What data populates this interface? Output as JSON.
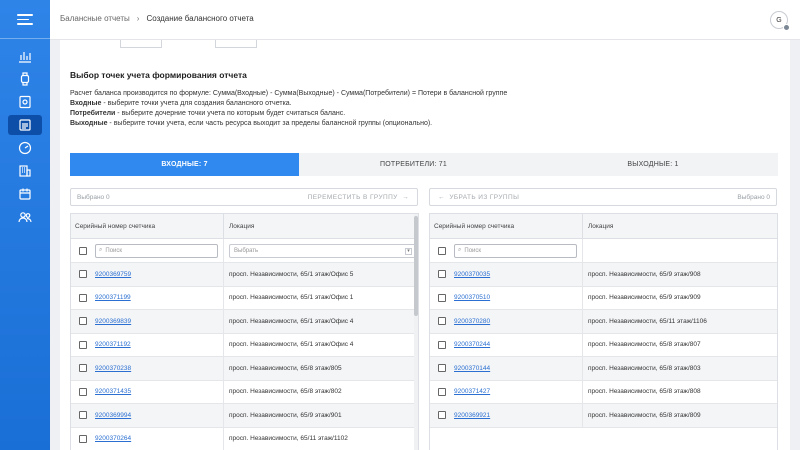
{
  "breadcrumb": {
    "parent": "Балансные отчеты",
    "separator": "›",
    "current": "Создание балансного отчета"
  },
  "user": {
    "initial": "G"
  },
  "sidebar": {
    "items": [
      {
        "icon": "chart-icon",
        "active": false
      },
      {
        "icon": "watch-icon",
        "active": false
      },
      {
        "icon": "settings-doc-icon",
        "active": false
      },
      {
        "icon": "report-icon",
        "active": true
      },
      {
        "icon": "gauge-icon",
        "active": false
      },
      {
        "icon": "building-icon",
        "active": false
      },
      {
        "icon": "calendar-icon",
        "active": false
      },
      {
        "icon": "users-icon",
        "active": false
      }
    ]
  },
  "section": {
    "title": "Выбор точек учета формирования отчета",
    "formula": "Расчет баланса производится по формуле: Сумма(Входные) - Сумма(Выходные) - Сумма(Потребители) = Потери в балансной группе",
    "inputs_term": "Входные",
    "inputs_desc": " - выберите точки учета для создания балансного отчетка.",
    "consumers_term": "Потребители",
    "consumers_desc": " - выберите дочерние точки учета по которым будет считаться баланс.",
    "outputs_term": "Выходные",
    "outputs_desc": " - выберите точки учета, если часть ресурса выходит за пределы балансной группы (опционально)."
  },
  "tabs": [
    {
      "label": "ВХОДНЫЕ: 7",
      "active": true
    },
    {
      "label": "ПОТРЕБИТЕЛИ: 71",
      "active": false
    },
    {
      "label": "ВЫХОДНЫЕ: 1",
      "active": false
    }
  ],
  "left_panel": {
    "selected": "Выбрано 0",
    "action": "ПЕРЕМЕСТИТЬ В ГРУППУ",
    "columns": {
      "serial": "Серийный номер счетчика",
      "location": "Локация"
    },
    "search_placeholder": "Поиск",
    "select_placeholder": "Выбрать",
    "rows": [
      {
        "serial": "9200369759",
        "location": "просп. Независимости, 65/1 этаж/Офис 5"
      },
      {
        "serial": "9200371199",
        "location": "просп. Независимости, 65/1 этаж/Офис 1"
      },
      {
        "serial": "9200369839",
        "location": "просп. Независимости, 65/1 этаж/Офис 4"
      },
      {
        "serial": "9200371192",
        "location": "просп. Независимости, 65/1 этаж/Офис 4"
      },
      {
        "serial": "9200370238",
        "location": "просп. Независимости, 65/8 этаж/805"
      },
      {
        "serial": "9200371435",
        "location": "просп. Независимости, 65/8 этаж/802"
      },
      {
        "serial": "9200369994",
        "location": "просп. Независимости, 65/9 этаж/901"
      },
      {
        "serial": "9200370264",
        "location": "просп. Независимости, 65/11 этаж/1102"
      }
    ]
  },
  "right_panel": {
    "selected": "Выбрано 0",
    "action": "УБРАТЬ ИЗ ГРУППЫ",
    "columns": {
      "serial": "Серийный номер счетчика",
      "location": "Локация"
    },
    "search_placeholder": "Поиск",
    "rows": [
      {
        "serial": "9200370035",
        "location": "просп. Независимости, 65/9 этаж/908"
      },
      {
        "serial": "9200370510",
        "location": "просп. Независимости, 65/9 этаж/909"
      },
      {
        "serial": "9200370280",
        "location": "просп. Независимости, 65/11 этаж/1106"
      },
      {
        "serial": "9200370244",
        "location": "просп. Независимости, 65/8 этаж/807"
      },
      {
        "serial": "9200370144",
        "location": "просп. Независимости, 65/8 этаж/803"
      },
      {
        "serial": "9200371427",
        "location": "просп. Независимости, 65/8 этаж/808"
      },
      {
        "serial": "9200369921",
        "location": "просп. Независимости, 65/8 этаж/809"
      }
    ]
  },
  "colors": {
    "accent": "#2f89ef",
    "sidebar": "#1f74dc",
    "link": "#2a6fd1"
  }
}
